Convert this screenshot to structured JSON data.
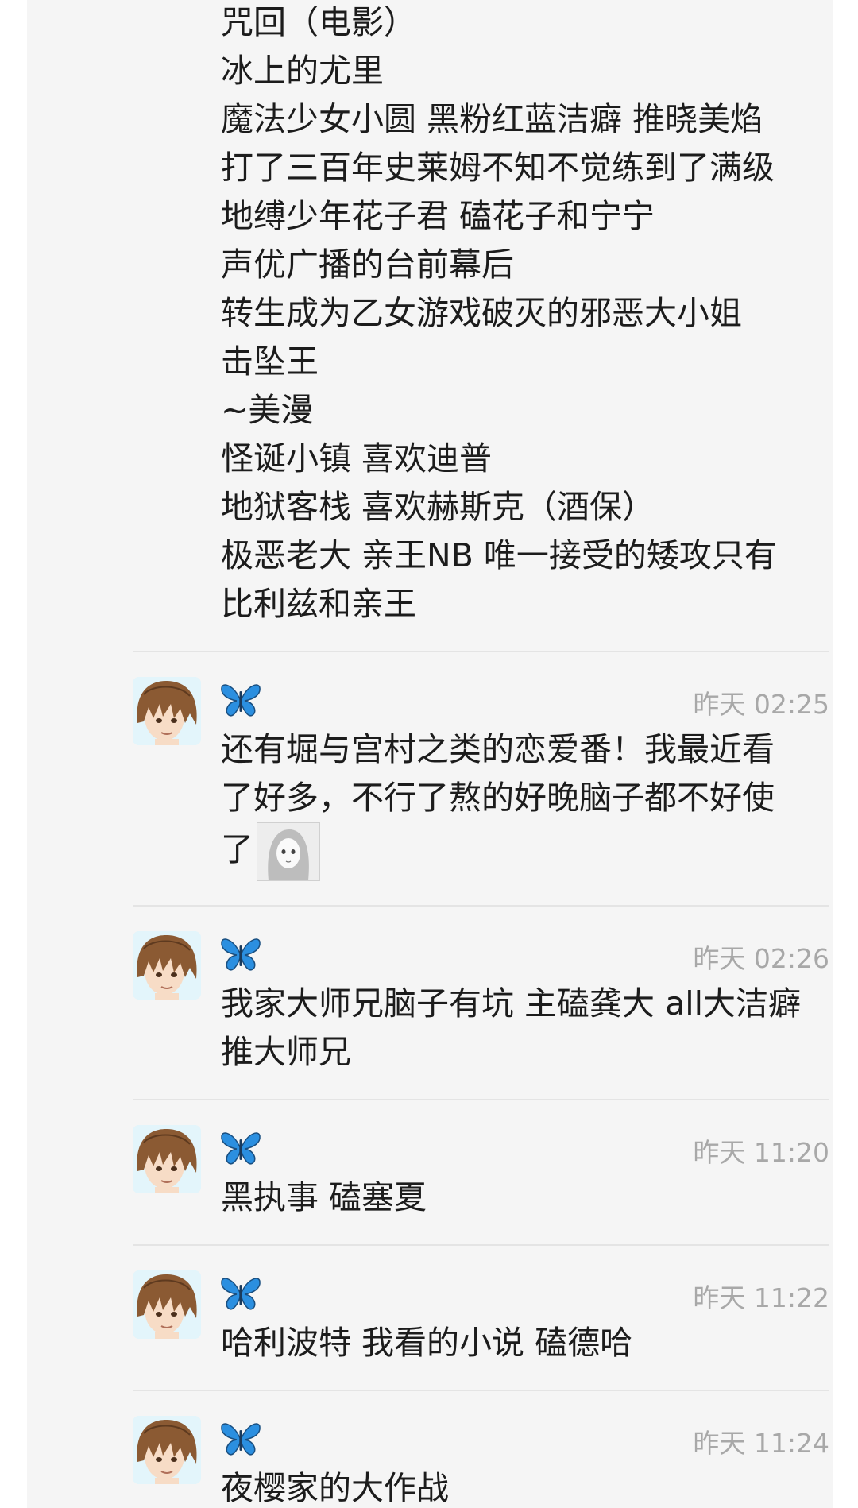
{
  "top_lines": [
    "咒回（电影）",
    "冰上的尤里",
    "魔法少女小圆 黑粉红蓝洁癖 推晓美焰",
    "打了三百年史莱姆不知不觉练到了满级",
    "地缚少年花子君 磕花子和宁宁",
    "声优广播的台前幕后",
    "转生成为乙女游戏破灭的邪恶大小姐",
    "击坠王",
    "~美漫",
    "怪诞小镇 喜欢迪普",
    "地狱客栈 喜欢赫斯克（酒保）",
    "极恶老大 亲王NB 唯一接受的矮攻只有",
    "比利兹和亲王"
  ],
  "comments": [
    {
      "time": "昨天 02:25",
      "lines": [
        "还有堀与宫村之类的恋爱番！我最近看",
        "了好多，不行了熬的好晚脑子都不好使",
        "了"
      ],
      "has_sticker": true
    },
    {
      "time": "昨天 02:26",
      "lines": [
        "我家大师兄脑子有坑 主磕龚大 all大洁癖",
        "推大师兄"
      ]
    },
    {
      "time": "昨天 11:20",
      "lines": [
        "黑执事 磕塞夏"
      ]
    },
    {
      "time": "昨天 11:22",
      "lines": [
        "哈利波特 我看的小说 磕德哈"
      ]
    },
    {
      "time": "昨天 11:24",
      "lines": [
        "夜樱家的大作战"
      ]
    }
  ],
  "icons": {
    "avatar": "anime-boy-avatar",
    "name": "butterfly-icon"
  },
  "colors": {
    "background": "#f5f5f5",
    "text": "#1c1c1c",
    "timestamp": "#a8a8a8",
    "butterfly": "#2b8fe0"
  }
}
